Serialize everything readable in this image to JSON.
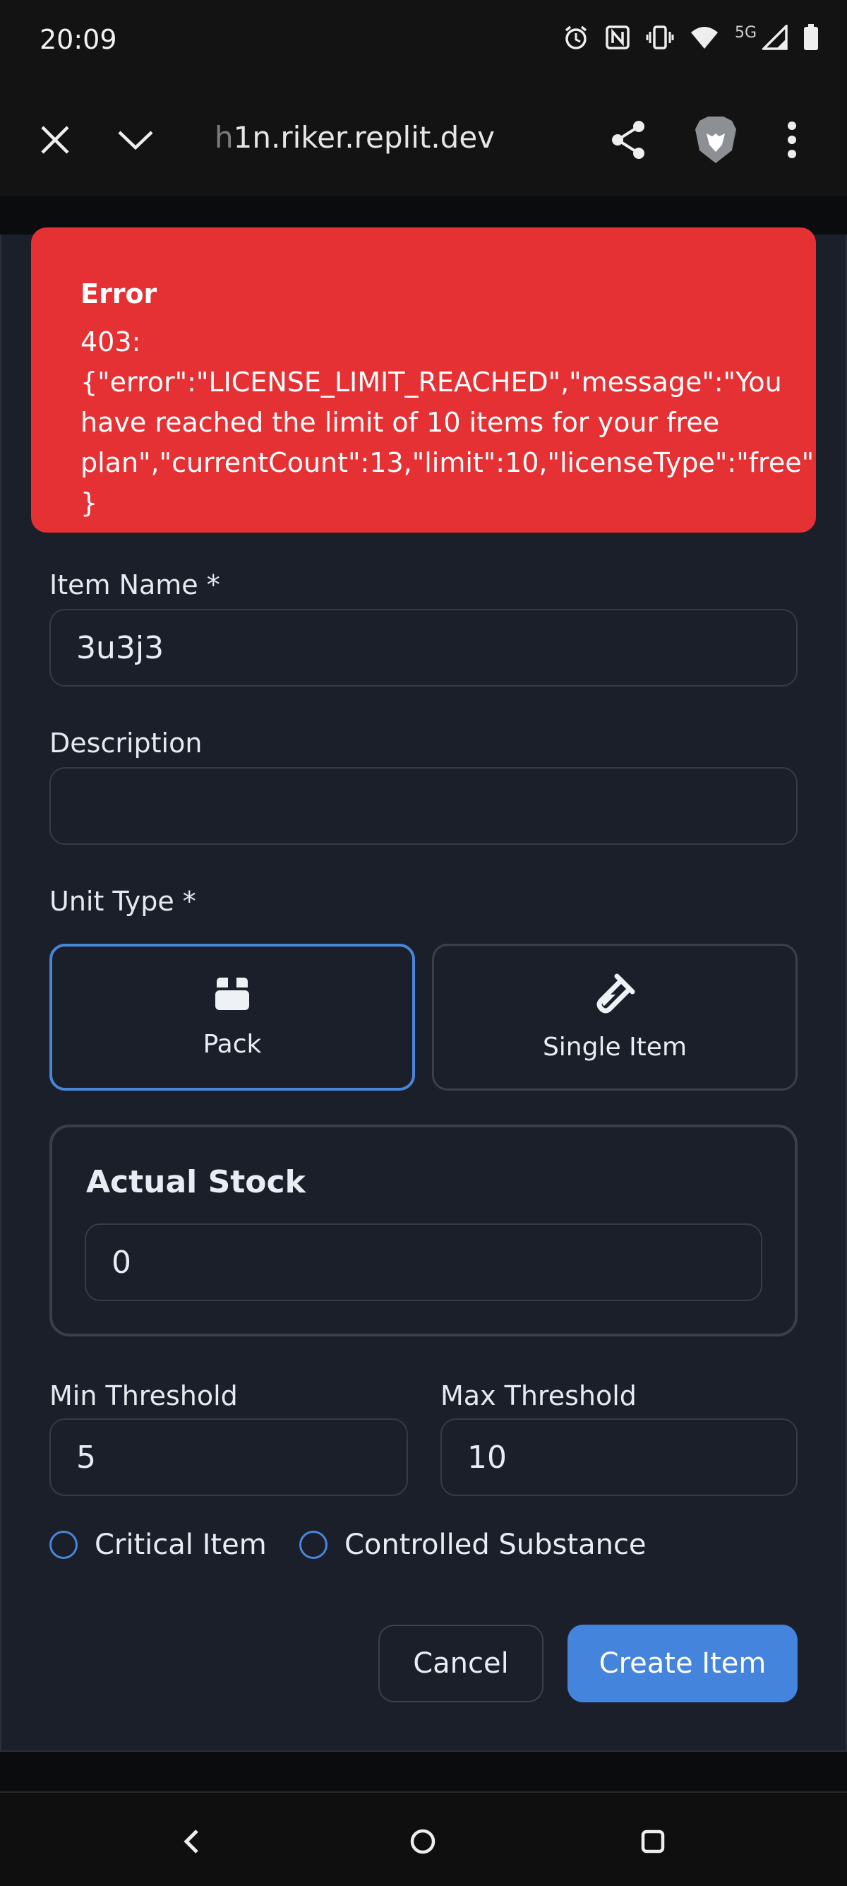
{
  "status_bar": {
    "time": "20:09",
    "network_label": "5G",
    "icons": [
      "alarm-icon",
      "nfc-icon",
      "vibrate-icon",
      "wifi-icon",
      "signal-icon",
      "battery-icon"
    ]
  },
  "browser": {
    "url_faded": "h",
    "url": "1n.riker.replit.dev",
    "icons": [
      "close-icon",
      "chevron-down-icon",
      "share-icon",
      "brave-lion-icon",
      "more-vert-icon"
    ]
  },
  "error": {
    "title": "Error",
    "message": "403: {\"error\":\"LICENSE_LIMIT_REACHED\",\"message\":\"You have reached the limit of 10 items for your free plan\",\"currentCount\":13,\"limit\":10,\"licenseType\":\"free\"}",
    "color": "#e53034"
  },
  "form": {
    "item_name_label": "Item Name *",
    "item_name_value": "3u3j3",
    "description_label": "Description",
    "description_value": "",
    "unit_type_label": "Unit Type *",
    "unit_types": [
      {
        "label": "Pack",
        "icon": "box-icon",
        "selected": true
      },
      {
        "label": "Single Item",
        "icon": "test-tube-icon",
        "selected": false
      }
    ],
    "stock_title": "Actual Stock",
    "stock_value": "0",
    "min_label": "Min Threshold",
    "min_value": "5",
    "max_label": "Max Threshold",
    "max_value": "10",
    "critical_label": "Critical Item",
    "controlled_label": "Controlled Substance",
    "cancel_label": "Cancel",
    "create_label": "Create Item",
    "accent": "#4584dc"
  },
  "nav": {
    "icons": [
      "back-icon",
      "home-icon",
      "recents-icon"
    ]
  }
}
